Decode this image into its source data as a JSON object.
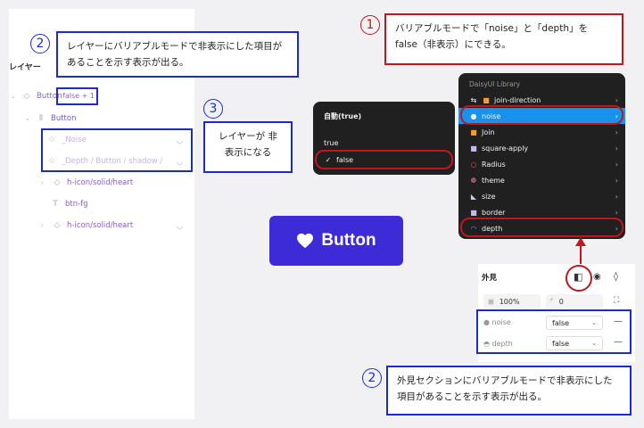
{
  "layers": {
    "title": "レイヤー",
    "root_label": "Button",
    "root_badge": "false + 1",
    "rows": [
      {
        "label": "Button"
      },
      {
        "label": "_Noise"
      },
      {
        "label": "_Depth / Button / shadow /"
      },
      {
        "label": "h-icon/solid/heart"
      },
      {
        "label": "btn-fg"
      },
      {
        "label": "h-icon/solid/heart"
      }
    ]
  },
  "callouts": {
    "c1_num": "1",
    "c1_text": "バリアブルモードで「noise」と「depth」を false（非表示）にできる。",
    "c2a_num": "2",
    "c2a_text": "レイヤーにバリアブルモードで非表示にした項目があることを示す表示が出る。",
    "c3_num": "3",
    "c3_text": "レイヤーが 非表示になる",
    "c2b_num": "2",
    "c2b_text": "外見セクションにバリアブルモードで非表示にした項目があることを示す表示が出る。"
  },
  "mode_menu": {
    "header": "自動(true)",
    "items": [
      "true",
      "false"
    ],
    "checked": "✓"
  },
  "library_menu": {
    "title": "DaisyUI Library",
    "items": [
      "join-direction",
      "noise",
      "Join",
      "square-apply",
      "Radius",
      "theme",
      "size",
      "border",
      "depth"
    ]
  },
  "preview": {
    "label": "Button",
    "icon": "heart-icon",
    "color": "#3e2bd8"
  },
  "appearance": {
    "title": "外見",
    "opacity": "100%",
    "radius": "0",
    "props": [
      {
        "name": "noise",
        "value": "false"
      },
      {
        "name": "depth",
        "value": "false"
      }
    ]
  },
  "colors": {
    "blue_annotation": "#1c2bd0",
    "red_annotation": "#c0161d",
    "menu_selected": "#1992ee"
  }
}
